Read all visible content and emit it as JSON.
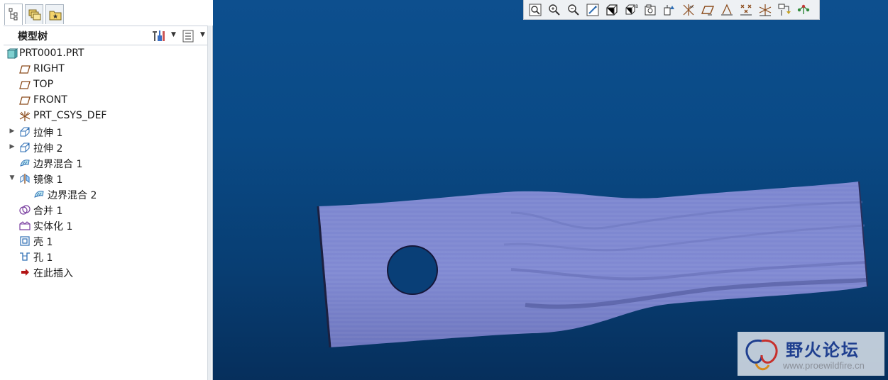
{
  "model_tree": {
    "title": "模型树",
    "tabs": [
      "model-tree-icon",
      "layers-icon",
      "favorites-icon"
    ],
    "items": [
      {
        "label": "PRT0001.PRT",
        "icon": "part-icon",
        "expander": ""
      },
      {
        "label": "RIGHT",
        "icon": "datum-plane-icon",
        "expander": ""
      },
      {
        "label": "TOP",
        "icon": "datum-plane-icon",
        "expander": ""
      },
      {
        "label": "FRONT",
        "icon": "datum-plane-icon",
        "expander": ""
      },
      {
        "label": "PRT_CSYS_DEF",
        "icon": "csys-icon",
        "expander": ""
      },
      {
        "label": "拉伸 1",
        "icon": "extrude-icon",
        "expander": "▶"
      },
      {
        "label": "拉伸 2",
        "icon": "extrude-icon",
        "expander": "▶"
      },
      {
        "label": "边界混合 1",
        "icon": "boundary-blend-icon",
        "expander": ""
      },
      {
        "label": "镜像 1",
        "icon": "mirror-icon",
        "expander": "▼"
      },
      {
        "label": "边界混合 2",
        "icon": "boundary-blend-icon",
        "expander": ""
      },
      {
        "label": "合并 1",
        "icon": "merge-icon",
        "expander": ""
      },
      {
        "label": "实体化 1",
        "icon": "solidify-icon",
        "expander": ""
      },
      {
        "label": "壳 1",
        "icon": "shell-icon",
        "expander": ""
      },
      {
        "label": "孔 1",
        "icon": "hole-icon",
        "expander": ""
      },
      {
        "label": "在此插入",
        "icon": "insert-here-icon",
        "expander": ""
      }
    ]
  },
  "toolbar": {
    "buttons": [
      "refit-icon",
      "zoom-in-icon",
      "zoom-out-icon",
      "repaint-icon",
      "display-style-icon",
      "saved-views-icon",
      "view-manager-icon",
      "annotation-display-icon",
      "datum-display-icon",
      "plane-display-icon",
      "axis-display-icon",
      "point-display-icon",
      "csys-display-icon",
      "spin-center-icon",
      "network-icon"
    ]
  },
  "watermark": {
    "title": "野火论坛",
    "url": "www.proewildfire.cn"
  },
  "colors": {
    "viewport_top": "#0d4f8e",
    "viewport_bottom": "#062f5c",
    "model_surface": "#7d86cc",
    "model_shadow": "#4f5699"
  }
}
